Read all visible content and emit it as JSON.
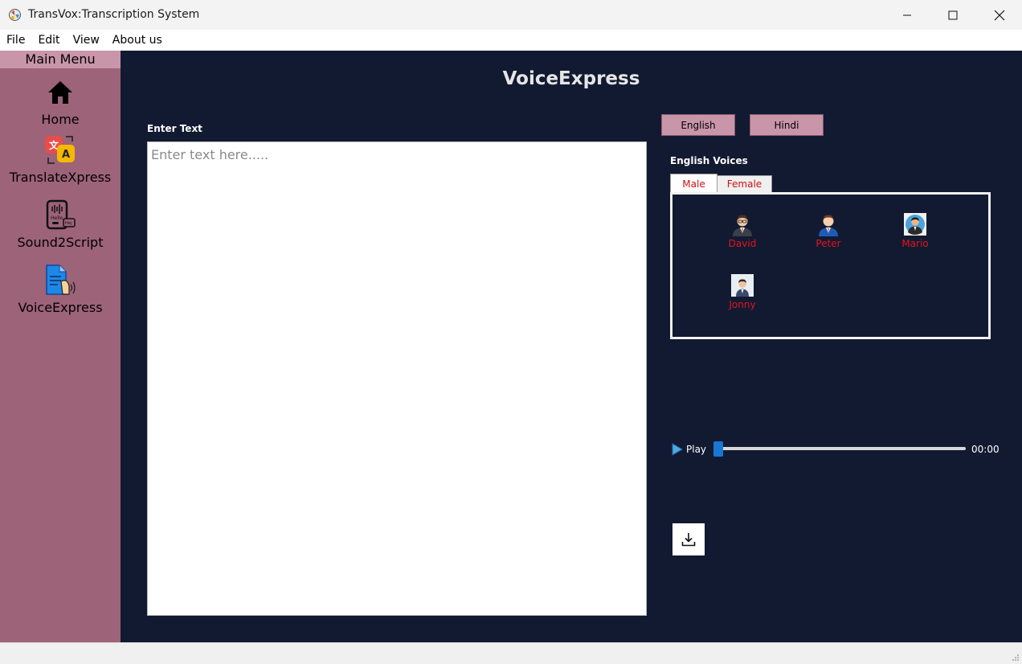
{
  "window": {
    "title": "TransVox:Transcription System",
    "icon": "app-logo-icon"
  },
  "menubar": {
    "items": [
      "File",
      "Edit",
      "View",
      "About us"
    ]
  },
  "sidebar": {
    "header": "Main Menu",
    "items": [
      {
        "label": "Home",
        "icon": "home-icon"
      },
      {
        "label": "TranslateXpress",
        "icon": "translate-icon"
      },
      {
        "label": "Sound2Script",
        "icon": "sound-to-script-icon"
      },
      {
        "label": "VoiceExpress",
        "icon": "voice-document-icon"
      }
    ],
    "colors": {
      "background": "#9d6378",
      "header": "#c995a9"
    }
  },
  "main": {
    "title": "VoiceExpress",
    "enter_text_label": "Enter Text",
    "text_input": {
      "value": "",
      "placeholder": "Enter text here....."
    },
    "language_buttons": [
      "English",
      "Hindi"
    ],
    "voices_label": "English Voices",
    "tabs": [
      {
        "label": "Male",
        "selected": true
      },
      {
        "label": "Female",
        "selected": false
      }
    ],
    "voices": [
      {
        "name": "David",
        "icon": "man-avatar-icon"
      },
      {
        "name": "Peter",
        "icon": "man-avatar-icon"
      },
      {
        "name": "Mario",
        "icon": "man-avatar-icon"
      },
      {
        "name": "Jonny",
        "icon": "man-avatar-icon"
      }
    ],
    "player": {
      "play_label": "Play",
      "time": "00:00",
      "progress": 0
    },
    "download_icon": "download-icon",
    "colors": {
      "background": "#121a32",
      "accent": "#1976d2",
      "voice_name": "#e5131c"
    }
  }
}
